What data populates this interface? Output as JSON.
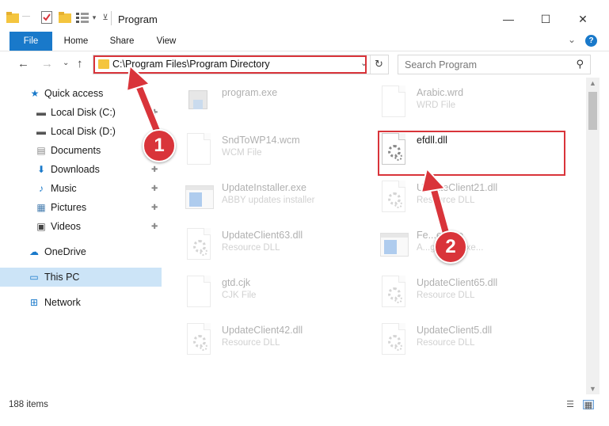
{
  "window": {
    "title": "Program",
    "minimize": "—",
    "maximize": "☐",
    "close": "✕"
  },
  "ribbon": {
    "tabs": [
      "File",
      "Home",
      "Share",
      "View"
    ],
    "collapse": "⌄",
    "help": "?"
  },
  "nav": {
    "back": "←",
    "forward": "→",
    "recent": "⌄",
    "up": "↑",
    "address": "C:\\Program Files\\Program Directory",
    "address_dropdown": "⌄",
    "refresh": "↻",
    "search_placeholder": "Search Program",
    "search_icon": "⚲"
  },
  "sidebar": {
    "items": [
      {
        "label": "Quick access",
        "icon": "star-icon",
        "glyph": "★",
        "color": "#1979ca"
      },
      {
        "label": "Local Disk (C:)",
        "icon": "drive-icon",
        "glyph": "▬",
        "color": "#555555",
        "pin": "📌"
      },
      {
        "label": "Local Disk (D:)",
        "icon": "drive-icon",
        "glyph": "▬",
        "color": "#555555"
      },
      {
        "label": "Documents",
        "icon": "documents-icon",
        "glyph": "▤",
        "color": "#888888",
        "pin": "📌"
      },
      {
        "label": "Downloads",
        "icon": "downloads-icon",
        "glyph": "⬇",
        "color": "#1979ca",
        "pin": "📌"
      },
      {
        "label": "Music",
        "icon": "music-icon",
        "glyph": "♪",
        "color": "#1979ca",
        "pin": "📌"
      },
      {
        "label": "Pictures",
        "icon": "pictures-icon",
        "glyph": "▦",
        "color": "#4a7fb0",
        "pin": "📌"
      },
      {
        "label": "Videos",
        "icon": "videos-icon",
        "glyph": "▣",
        "color": "#444444",
        "pin": "📌"
      },
      {
        "label": "OneDrive",
        "icon": "cloud-icon",
        "glyph": "☁",
        "color": "#1979ca"
      },
      {
        "label": "This PC",
        "icon": "computer-icon",
        "glyph": "▭",
        "color": "#1979ca"
      },
      {
        "label": "Network",
        "icon": "network-icon",
        "glyph": "⊞",
        "color": "#1979ca"
      }
    ]
  },
  "files": [
    {
      "name": "program.exe",
      "type": ""
    },
    {
      "name": "Arabic.wrd",
      "type": "WRD File"
    },
    {
      "name": "SndToWP14.wcm",
      "type": "WCM File"
    },
    {
      "name": "efdll.dll",
      "type": ""
    },
    {
      "name": "UpdateInstaller.exe",
      "type": "ABBY updates installer"
    },
    {
      "name": "UpdateClient21.dll",
      "type": "Resource DLL"
    },
    {
      "name": "UpdateClient63.dll",
      "type": "Resource DLL"
    },
    {
      "name": "Fe...er.exe",
      "type": "A...ground exe..."
    },
    {
      "name": "gtd.cjk",
      "type": "CJK File"
    },
    {
      "name": "UpdateClient65.dll",
      "type": "Resource DLL"
    },
    {
      "name": "UpdateClient42.dll",
      "type": "Resource DLL"
    },
    {
      "name": "UpdateClient5.dll",
      "type": "Resource DLL"
    }
  ],
  "annotations": {
    "step1": "1",
    "step2": "2",
    "color": "#d9343a"
  },
  "status": {
    "count": "188 items"
  }
}
